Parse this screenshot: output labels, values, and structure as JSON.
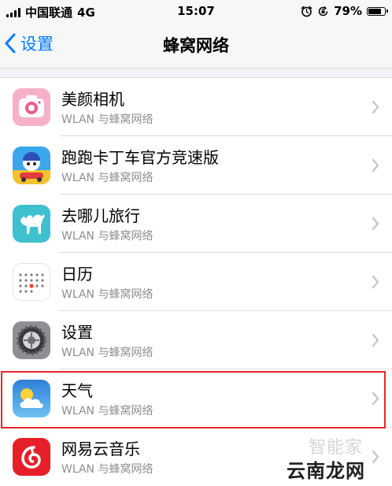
{
  "status_bar": {
    "carrier": "中国联通",
    "network": "4G",
    "time": "15:07",
    "battery": "79%",
    "battery_level": 0.79
  },
  "nav": {
    "back_label": "设置",
    "title": "蜂窝网络"
  },
  "apps": [
    {
      "name": "美颜相机",
      "subtitle": "WLAN 与蜂窝网络",
      "icon": "beauty-camera-icon"
    },
    {
      "name": "跑跑卡丁车官方竞速版",
      "subtitle": "WLAN 与蜂窝网络",
      "icon": "kart-rider-icon"
    },
    {
      "name": "去哪儿旅行",
      "subtitle": "WLAN 与蜂窝网络",
      "icon": "qunar-camel-icon"
    },
    {
      "name": "日历",
      "subtitle": "WLAN 与蜂窝网络",
      "icon": "calendar-icon"
    },
    {
      "name": "设置",
      "subtitle": "WLAN 与蜂窝网络",
      "icon": "settings-gear-icon"
    },
    {
      "name": "天气",
      "subtitle": "WLAN 与蜂窝网络",
      "icon": "weather-icon"
    },
    {
      "name": "网易云音乐",
      "subtitle": "WLAN 与蜂窝网络",
      "icon": "netease-music-icon"
    }
  ],
  "colors": {
    "accent": "#007aff",
    "highlight_border": "#e8262e"
  },
  "watermark": {
    "small": "智能家",
    "logo": "云南龙网"
  }
}
